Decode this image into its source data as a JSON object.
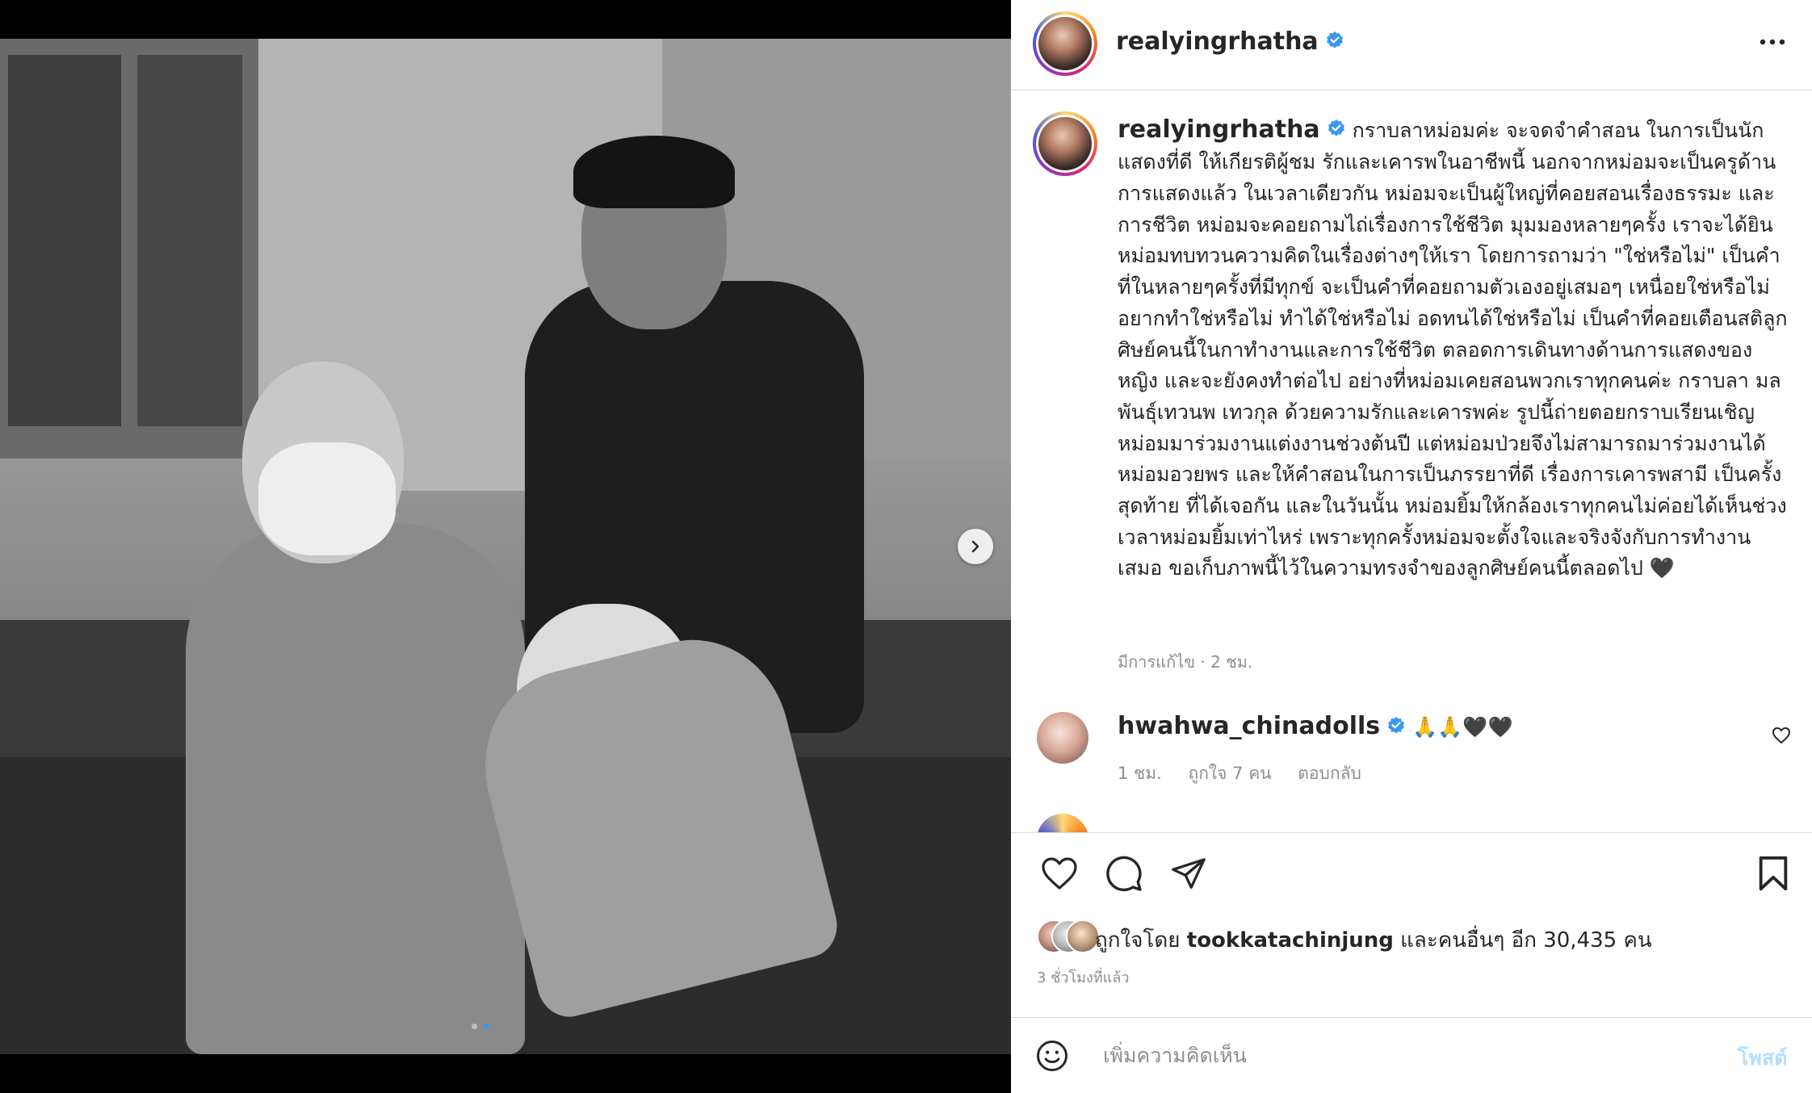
{
  "post": {
    "author": "realyingrhatha",
    "verified": true
  },
  "caption": {
    "username": "realyingrhatha",
    "text": "กราบลาหม่อมค่ะ จะจดจำคำสอน ในการเป็นนักแสดงที่ดี ให้เกียรติผู้ชม รักและเคารพในอาชีพนี้ นอกจากหม่อมจะเป็นครูด้านการแสดงแล้ว ในเวลาเดียวกัน หม่อมจะเป็นผู้ใหญ่ที่คอยสอนเรื่องธรรมะ และการชีวิต หม่อมจะคอยถามไถ่เรื่องการใช้ชีวิต มุมมองหลายๆครั้ง เราจะได้ยินหม่อมทบทวนความคิดในเรื่องต่างๆให้เรา โดยการถามว่า \"ใช่หรือไม่\" เป็นคำที่ในหลายๆครั้งที่มีทุกข์ จะเป็นคำที่คอยถามตัวเองอยู่เสมอๆ เหนื่อยใช่หรือไม่ อยากทำใช่หรือไม่ ทำได้ใช่หรือไม่ อดทนได้ใช่หรือไม่ เป็นคำที่คอยเตือนสติลูกศิษย์คนนี้ในกาทำงานและการใช้ชีวิต ตลอดการเดินทางด้านการแสดงของหญิง และจะยังคงทำต่อไป อย่างที่หม่อมเคยสอนพวกเราทุกคนค่ะ กราบลา มล พันธุ์เทวนพ เทวกุล ด้วยความรักและเคารพค่ะ รูปนี้ถ่ายตอยกราบเรียนเชิญหม่อมมาร่วมงานแต่งงานช่วงต้นปี แต่หม่อมป่วยจึงไม่สามารถมาร่วมงานได้ หม่อมอวยพร และให้คำสอนในการเป็นภรรยาที่ดี เรื่องการเคารพสามี เป็นครั้งสุดท้าย ที่ได้เจอกัน และในวันนั้น หม่อมยิ้มให้กล้องเราทุกคนไม่ค่อยได้เห็นช่วงเวลาหม่อมยิ้มเท่าไหร่ เพราะทุกครั้งหม่อมจะตั้งใจและจริงจังกับการทำงานเสมอ ขอเก็บภาพนี้ไว้ในความทรงจำของลูกศิษย์คนนี้ตลอดไป 🖤",
    "meta": "มีการแก้ไข · 2 ชม."
  },
  "comments": [
    {
      "username": "hwahwa_chinadolls",
      "verified": true,
      "text": "🙏🙏🖤🖤",
      "time": "1 ชม.",
      "likes": "ถูกใจ 7 คน",
      "reply": "ตอบกลับ"
    }
  ],
  "likes": {
    "prefix": "ถูกใจโดย",
    "user": "tookkatachinjung",
    "suffix": "และคนอื่นๆ อีก 30,435 คน"
  },
  "time_ago": "3 ชั่วโมงที่แล้ว",
  "add_comment": {
    "placeholder": "เพิ่มความคิดเห็น",
    "post_label": "โพสต์"
  },
  "carousel": {
    "slide_count": 2,
    "current_slide": 2
  },
  "icons": {
    "more": "more-horizontal-icon",
    "verified": "verified-badge-icon",
    "like": "heart-icon",
    "comment": "comment-bubble-icon",
    "share": "paper-plane-icon",
    "save": "bookmark-icon",
    "emoji": "smiley-icon",
    "next": "chevron-right-icon"
  },
  "colors": {
    "accent": "#3797f0",
    "verified": "#3897f0",
    "post_disabled": "#b2dffc",
    "secondary_text": "#8e8e8e",
    "divider": "#dbdbdb"
  }
}
